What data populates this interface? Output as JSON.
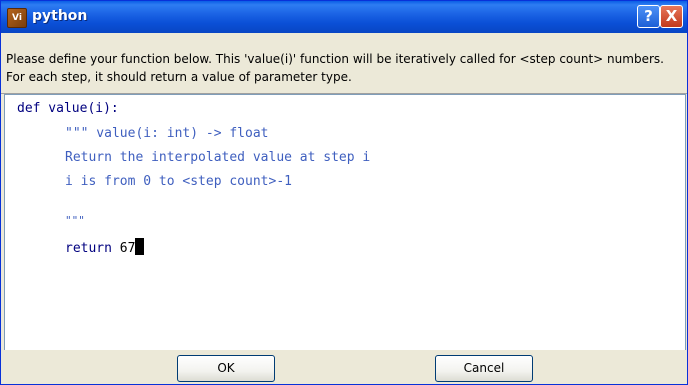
{
  "window": {
    "title": "python",
    "app_icon_text": "Vi",
    "help_glyph": "?",
    "close_glyph": "X"
  },
  "info": {
    "text": "Please define your function below. This 'value(i)' function will be iteratively called for <step count> numbers. For each step, it should return a value of parameter type."
  },
  "editor": {
    "line1_kw": "def",
    "line1_rest": " value(i):",
    "line2": "\"\"\" value(i: int) -> float",
    "line3": "Return the interpolated value at step i",
    "line4": "i is from 0 to <step count>-1",
    "line5": "\"\"\"",
    "line6_kw": "return",
    "line6_rest": " 67"
  },
  "buttons": {
    "ok": "OK",
    "cancel": "Cancel"
  },
  "colors": {
    "titlebar": "#0a4fd6",
    "keyword": "#00007f",
    "docstring": "#3f5fbf"
  }
}
